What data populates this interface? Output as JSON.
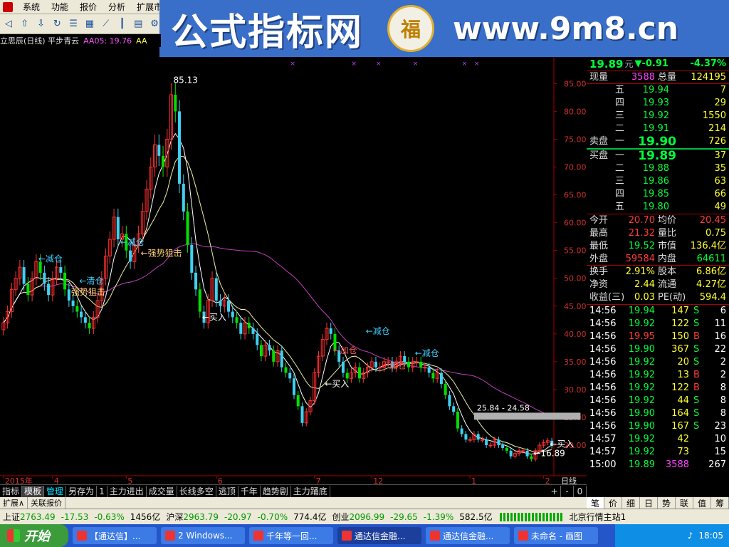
{
  "menu": [
    "系统",
    "功能",
    "报价",
    "分析",
    "扩展市"
  ],
  "banner": {
    "cn": "公式指标网",
    "seal": "福",
    "url": "www.9m8.cn"
  },
  "title": {
    "name": "立思辰(日线) 平步青云",
    "aa5": "AA05: 19.76",
    "aa": "AA"
  },
  "quote": {
    "price": "19.89",
    "yuan": "元",
    "change": "▼-0.91",
    "pct": "-4.37%",
    "xianliang_label": "现量",
    "xianliang": "3588",
    "zongliang_label": "总量",
    "zongliang": "124195",
    "mai_chu_label": "卖盘",
    "mai_ru_label": "买盘",
    "sells": [
      {
        "lvl": "五",
        "price": "19.94",
        "vol": "7"
      },
      {
        "lvl": "四",
        "price": "19.93",
        "vol": "29"
      },
      {
        "lvl": "三",
        "price": "19.92",
        "vol": "1550"
      },
      {
        "lvl": "二",
        "price": "19.91",
        "vol": "214"
      },
      {
        "lvl": "一",
        "price": "19.90",
        "vol": "726"
      }
    ],
    "buys": [
      {
        "lvl": "一",
        "price": "19.89",
        "vol": "37"
      },
      {
        "lvl": "二",
        "price": "19.88",
        "vol": "35"
      },
      {
        "lvl": "三",
        "price": "19.86",
        "vol": "63"
      },
      {
        "lvl": "四",
        "price": "19.85",
        "vol": "66"
      },
      {
        "lvl": "五",
        "price": "19.80",
        "vol": "49"
      }
    ],
    "stats": [
      {
        "l1": "今开",
        "v1": "20.70",
        "c1": "red",
        "l2": "均价",
        "v2": "20.45",
        "c2": "red"
      },
      {
        "l1": "最高",
        "v1": "21.32",
        "c1": "red",
        "l2": "量比",
        "v2": "0.75",
        "c2": "yel"
      },
      {
        "l1": "最低",
        "v1": "19.52",
        "c1": "green",
        "l2": "市值",
        "v2": "136.4亿",
        "c2": "yel"
      },
      {
        "l1": "外盘",
        "v1": "59584",
        "c1": "red",
        "l2": "内盘",
        "v2": "64611",
        "c2": "green"
      },
      {
        "l1": "换手",
        "v1": "2.91%",
        "c1": "yel",
        "l2": "股本",
        "v2": "6.86亿",
        "c2": "yel"
      },
      {
        "l1": "净资",
        "v1": "2.44",
        "c1": "yel",
        "l2": "流通",
        "v2": "4.27亿",
        "c2": "yel"
      },
      {
        "l1": "收益(三)",
        "v1": "0.03",
        "c1": "yel",
        "l2": "PE(动)",
        "v2": "594.4",
        "c2": "yel"
      }
    ],
    "ticks": [
      {
        "t": "14:56",
        "p": "19.94",
        "v": "147",
        "bs": "S",
        "n": "6"
      },
      {
        "t": "14:56",
        "p": "19.92",
        "v": "122",
        "bs": "S",
        "n": "11"
      },
      {
        "t": "14:56",
        "p": "19.95",
        "v": "150",
        "bs": "B",
        "n": "16"
      },
      {
        "t": "14:56",
        "p": "19.90",
        "v": "367",
        "bs": "S",
        "n": "22"
      },
      {
        "t": "14:56",
        "p": "19.92",
        "v": "20",
        "bs": "S",
        "n": "2"
      },
      {
        "t": "14:56",
        "p": "19.92",
        "v": "13",
        "bs": "B",
        "n": "2"
      },
      {
        "t": "14:56",
        "p": "19.92",
        "v": "122",
        "bs": "B",
        "n": "8"
      },
      {
        "t": "14:56",
        "p": "19.92",
        "v": "44",
        "bs": "S",
        "n": "8"
      },
      {
        "t": "14:56",
        "p": "19.90",
        "v": "164",
        "bs": "S",
        "n": "8"
      },
      {
        "t": "14:56",
        "p": "19.90",
        "v": "167",
        "bs": "S",
        "n": "23"
      },
      {
        "t": "14:57",
        "p": "19.92",
        "v": "42",
        "bs": "",
        "n": "10"
      },
      {
        "t": "14:57",
        "p": "19.92",
        "v": "73",
        "bs": "",
        "n": "15"
      },
      {
        "t": "15:00",
        "p": "19.89",
        "v": "3588",
        "bs": "",
        "n": "267"
      }
    ]
  },
  "chart_data": {
    "type": "candlestick",
    "yticks": [
      20,
      25,
      30,
      35,
      40,
      45,
      50,
      55,
      60,
      65,
      70,
      75,
      80,
      85
    ],
    "ytick_labels": [
      "20.00",
      "25.00",
      "30.00",
      "35.00",
      "40.00",
      "45.00",
      "50.00",
      "55.00",
      "60.00",
      "65.00",
      "70.00",
      "75.00",
      "80.00",
      "85.00"
    ],
    "ylim": [
      14.5,
      88.5
    ],
    "xlabels": [
      {
        "i": 0,
        "t": "2015年"
      },
      {
        "i": 12,
        "t": "4"
      },
      {
        "i": 30,
        "t": "5"
      },
      {
        "i": 52,
        "t": "6"
      },
      {
        "i": 76,
        "t": "7"
      },
      {
        "i": 90,
        "t": "12"
      },
      {
        "i": 114,
        "t": "1"
      },
      {
        "i": 132,
        "t": "2"
      }
    ],
    "xaxis_right_label": "日线",
    "annotations": [
      {
        "i": 41,
        "price": 85.13,
        "text": "85.13",
        "color": "#ffffff"
      },
      {
        "i": 8,
        "price": 53,
        "text": "←减仓",
        "color": "#40d0ff"
      },
      {
        "i": 18,
        "price": 49,
        "text": "←清仓",
        "color": "#40d0ff"
      },
      {
        "i": 28,
        "price": 56,
        "text": "←减仓",
        "color": "#40d0ff"
      },
      {
        "i": 16,
        "price": 47,
        "text": "强势狙击",
        "color": "#ffd070"
      },
      {
        "i": 33,
        "price": 54,
        "text": "←强势狙击",
        "color": "#ffd070"
      },
      {
        "i": 48,
        "price": 42.5,
        "text": "←买入",
        "color": "#ffffff"
      },
      {
        "i": 80,
        "price": 36.5,
        "text": "←加仓",
        "color": "#ff5050"
      },
      {
        "i": 88,
        "price": 40,
        "text": "←减仓",
        "color": "#40d0ff"
      },
      {
        "i": 100,
        "price": 36,
        "text": "←减仓",
        "color": "#40d0ff"
      },
      {
        "i": 92,
        "price": 33.8,
        "text": "←加仓",
        "color": "#ff5050"
      },
      {
        "i": 78,
        "price": 30.5,
        "text": "←买入",
        "color": "#ffffff"
      },
      {
        "i": 129,
        "price": 18,
        "text": "←16.89",
        "color": "#ffffff"
      },
      {
        "i": 133,
        "price": 19.7,
        "text": "←买入",
        "color": "#ffffff"
      }
    ],
    "range_box": {
      "from": 115,
      "to": 141,
      "low": 24.58,
      "high": 25.84,
      "text": "25.84 - 24.58"
    },
    "closes": [
      42,
      44,
      48,
      50,
      52,
      49,
      47,
      50,
      53,
      51,
      49,
      47,
      50,
      52,
      51,
      48,
      46,
      45,
      44,
      43,
      42,
      41,
      43,
      46,
      50,
      54,
      57,
      61,
      57,
      58,
      55,
      53,
      56,
      58,
      62,
      66,
      70,
      74,
      72,
      70,
      75,
      83,
      80,
      67,
      62,
      56,
      51,
      48,
      44,
      42,
      46,
      50,
      46,
      45,
      46,
      44,
      43,
      42,
      40,
      42,
      41,
      40,
      38,
      36,
      38,
      37,
      35,
      37,
      34,
      33,
      32,
      29,
      27,
      24,
      26,
      28,
      33,
      36,
      39,
      41,
      40,
      37,
      35,
      33,
      32,
      33,
      34,
      32,
      33,
      34,
      35,
      34,
      34,
      35,
      35,
      34,
      35,
      36,
      35,
      34,
      35,
      35,
      34,
      34,
      33,
      32,
      33,
      31,
      29,
      27,
      26,
      23,
      22,
      21,
      21,
      22,
      21,
      21,
      20,
      20,
      21,
      20,
      19.5,
      19,
      18,
      18.5,
      19,
      19,
      18,
      17.5,
      19,
      20,
      20.5,
      20.8,
      19.89
    ]
  },
  "tabs": [
    "指标",
    "模板",
    "管理",
    "另存为",
    "1",
    "主力进出",
    "成交量",
    "长线多空",
    "逃顶",
    "千年",
    "趋势剧",
    "主力踊底"
  ],
  "tab_right": [
    "+",
    "-",
    "0"
  ],
  "bottom2": [
    "扩展∧",
    "关联报价"
  ],
  "rtabs": [
    "笔",
    "价",
    "细",
    "日",
    "势",
    "联",
    "值",
    "筹"
  ],
  "status": {
    "sh_label": "上证",
    "sh": "2763.49",
    "sh_c": "-17.53",
    "sh_p": "-0.63%",
    "sh_v": "1456亿",
    "sz_label": "沪深",
    "sz": "2963.79",
    "sz_c": "-20.97",
    "sz_p": "-0.70%",
    "sz_v": "774.4亿",
    "cy_label": "创业",
    "cy": "2096.99",
    "cy_c": "-29.65",
    "cy_p": "-1.39%",
    "cy_v": "582.5亿",
    "server": "北京行情主站1"
  },
  "taskbar": {
    "start": "开始",
    "items": [
      "【通达信】...",
      "2 Windows...",
      "千年等一回...",
      "通达信金融...",
      "通达信金融...",
      "未命名 - 画图"
    ],
    "time": "18:05"
  }
}
